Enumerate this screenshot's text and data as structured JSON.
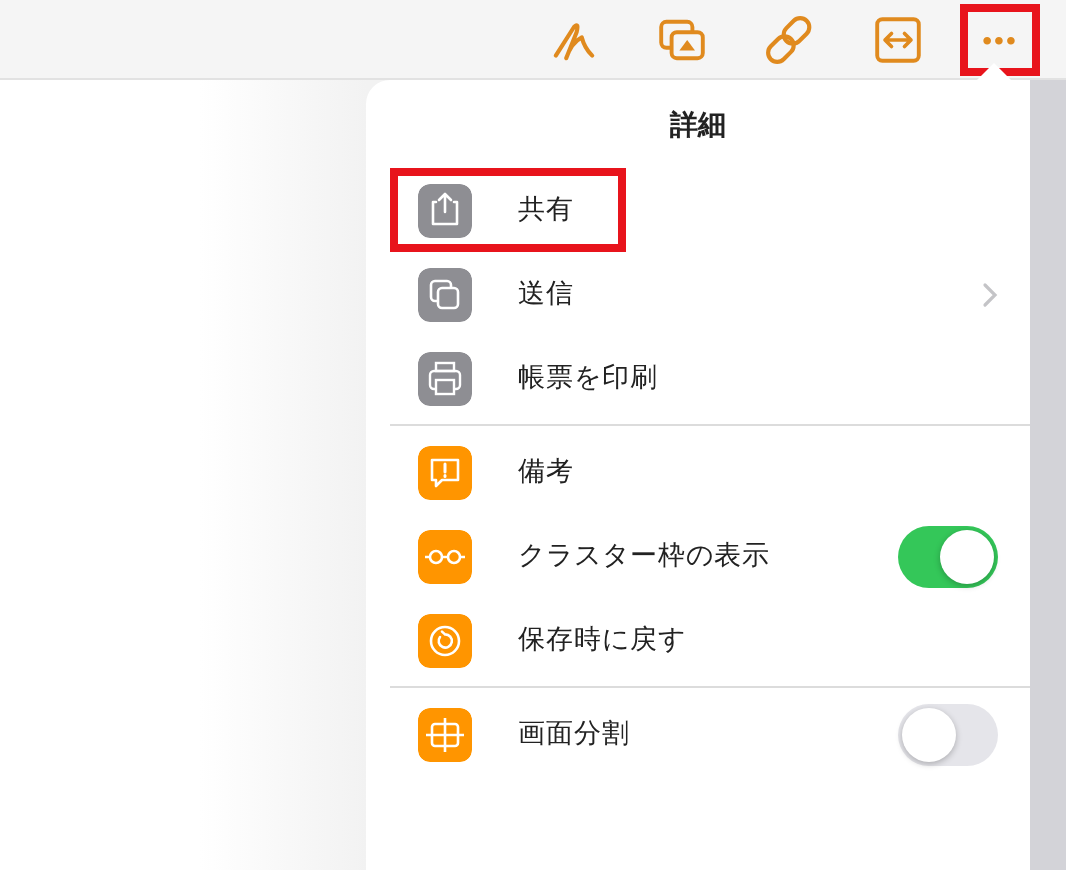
{
  "toolbar": {
    "buttons": [
      {
        "kind": "pen",
        "highlighted": false
      },
      {
        "kind": "media",
        "highlighted": false
      },
      {
        "kind": "link",
        "highlighted": false
      },
      {
        "kind": "fit",
        "highlighted": false
      },
      {
        "kind": "more",
        "label": "•••",
        "highlighted": true
      }
    ]
  },
  "popover": {
    "title": "詳細",
    "sections": [
      {
        "items": [
          {
            "kind": "action",
            "label": "共有",
            "color": "#8e8e93",
            "highlighted": true
          },
          {
            "kind": "submenu",
            "label": "送信",
            "color": "#8e8e93",
            "highlighted": false
          },
          {
            "kind": "action",
            "label": "帳票を印刷",
            "color": "#8e8e93",
            "highlighted": false
          }
        ]
      },
      {
        "items": [
          {
            "kind": "action",
            "label": "備考",
            "color": "#ff9500",
            "highlighted": false
          },
          {
            "kind": "toggle",
            "label": "クラスター枠の表示",
            "color": "#ff9500",
            "on": true,
            "highlighted": false
          },
          {
            "kind": "action",
            "label": "保存時に戻す",
            "color": "#ff9500",
            "highlighted": false
          }
        ]
      },
      {
        "items": [
          {
            "kind": "toggle",
            "label": "画面分割",
            "color": "#ff9500",
            "on": false,
            "highlighted": false
          }
        ]
      }
    ]
  }
}
